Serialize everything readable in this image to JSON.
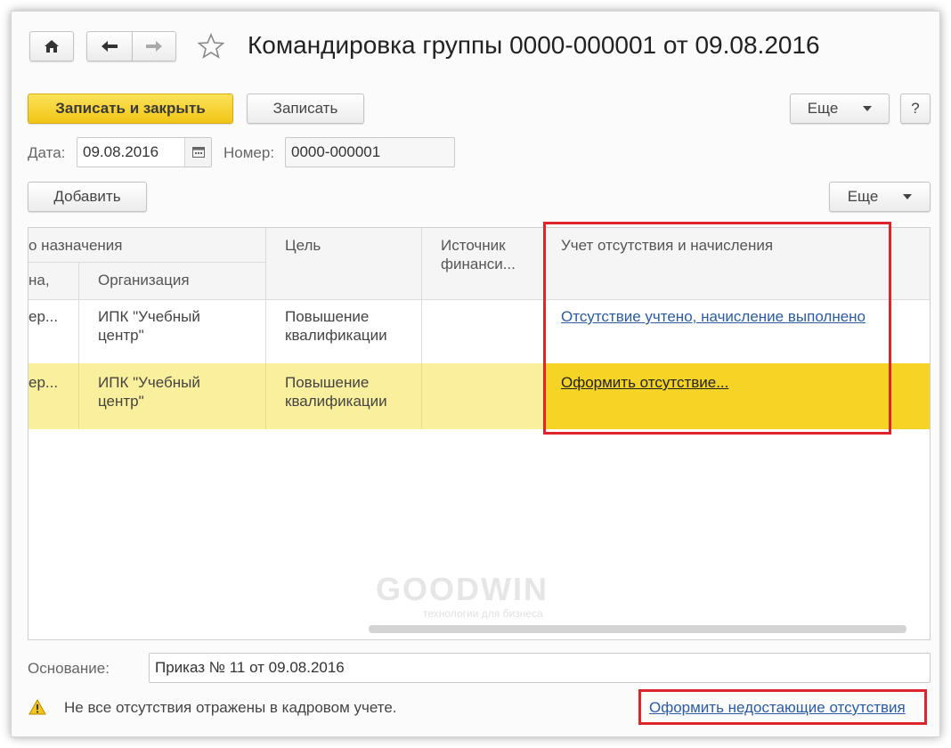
{
  "window": {
    "title": "Командировка группы 0000-000001 от 09.08.2016"
  },
  "toolbar": {
    "save_close_label": "Записать и закрыть",
    "save_label": "Записать",
    "more_label": "Еще",
    "help_label": "?"
  },
  "header": {
    "date_label": "Дата:",
    "date_value": "09.08.2016",
    "number_label": "Номер:",
    "number_value": "0000-000001"
  },
  "table_toolbar": {
    "add_label": "Добавить",
    "more_label": "Еще"
  },
  "table": {
    "group_header": "о назначения",
    "sub_col_1": "на,",
    "sub_col_2": "Организация",
    "col_goal": "Цель",
    "col_source_line1": "Источник",
    "col_source_line2": "финанси...",
    "col_absence": "Учет отсутствия и начисления",
    "rows": [
      {
        "col1": "ер...",
        "org_line1": "ИПК \"Учебный",
        "org_line2": "центр\"",
        "goal_line1": "Повышение",
        "goal_line2": "квалификации",
        "absence": "Отсутствие учтено, начисление выполнено"
      },
      {
        "col1": "ер...",
        "org_line1": "ИПК \"Учебный",
        "org_line2": "центр\"",
        "goal_line1": "Повышение",
        "goal_line2": "квалификации",
        "absence": "Оформить отсутствие..."
      }
    ]
  },
  "watermark": {
    "text": "GOODWIN",
    "subtext": "технологии для бизнеса"
  },
  "footer": {
    "basis_label": "Основание:",
    "basis_value": "Приказ № 11 от 09.08.2016",
    "warning_text": "Не все отсутствия отражены в кадровом учете.",
    "action_link": "Оформить недостающие отсутствия"
  },
  "colors": {
    "primary_button": "#f2c516",
    "selected_row": "#f5d426",
    "highlight_box": "#e0242b",
    "link": "#2a5ca6"
  },
  "icons": {
    "home": "home-icon",
    "back": "arrow-left-icon",
    "forward": "arrow-right-icon",
    "favorite": "star-icon",
    "calendar": "calendar-icon",
    "warning": "warning-icon"
  }
}
